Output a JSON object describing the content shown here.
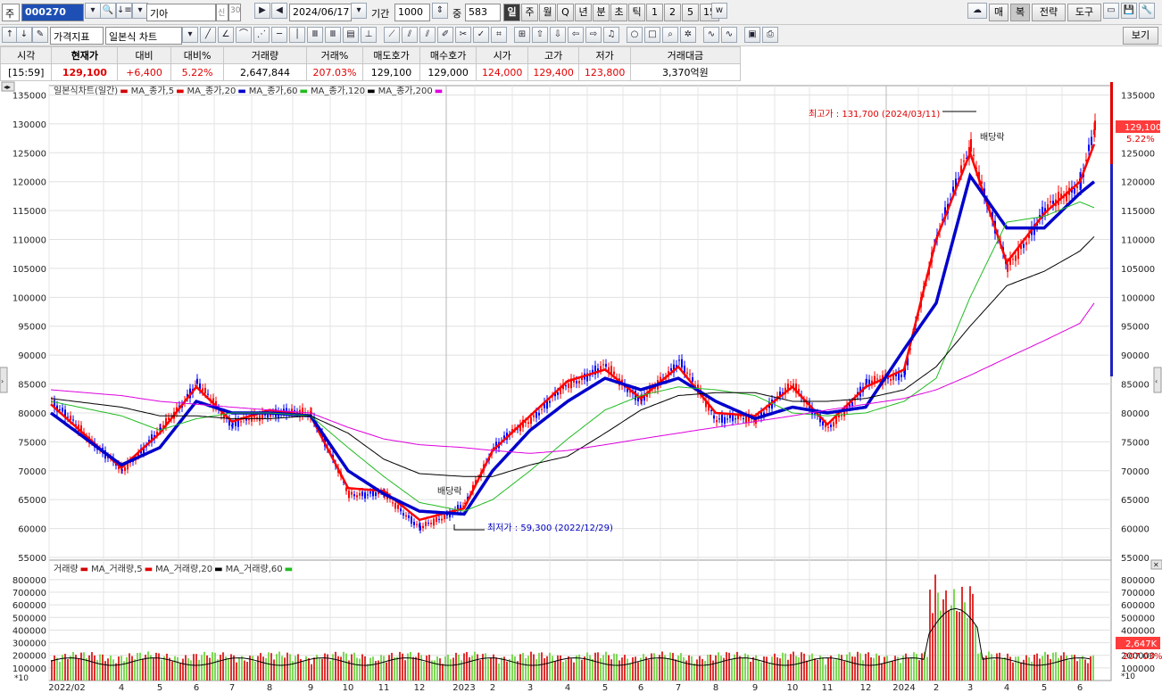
{
  "toolbar": {
    "prefix_label": "주",
    "code_value": "000270",
    "name_value": "기아",
    "tag_credit": "신",
    "tag_grade": "30",
    "date_value": "2024/06/17",
    "period_label": "기간",
    "period_value": "1000",
    "mid_label": "중",
    "mid_value": "583",
    "period_tabs": [
      "일",
      "주",
      "월",
      "Q",
      "년",
      "분",
      "초",
      "틱",
      "1",
      "2",
      "5",
      "15"
    ],
    "right_buttons": [
      "매",
      "복",
      "전략",
      "도구"
    ]
  },
  "toolbar2": {
    "indicator_label": "가격지표",
    "chart_type_value": "일본식 차트",
    "view_button": "보기"
  },
  "quote": {
    "headers": [
      "시각",
      "현재가",
      "대비",
      "대비%",
      "거래량",
      "거래%",
      "매도호가",
      "매수호가",
      "시가",
      "고가",
      "저가",
      "거래대금"
    ],
    "values": [
      "[15:59]",
      "129,100",
      "+6,400",
      "5.22%",
      "2,647,844",
      "207.03%",
      "129,100",
      "129,000",
      "124,000",
      "129,400",
      "123,800",
      "3,370억원"
    ]
  },
  "price_panel": {
    "legend": [
      {
        "text": "일본식차트(일간)",
        "color": "#d00000"
      },
      {
        "text": "MA_종가,5",
        "color": "#e00000"
      },
      {
        "text": "MA_종가,20",
        "color": "#0000cc"
      },
      {
        "text": "MA_종가,60",
        "color": "#22bb22"
      },
      {
        "text": "MA_종가,120",
        "color": "#000000"
      },
      {
        "text": "MA_종가,200",
        "color": "#dd00dd"
      }
    ],
    "y_ticks": [
      135000,
      130000,
      125000,
      120000,
      115000,
      110000,
      105000,
      100000,
      95000,
      90000,
      85000,
      80000,
      75000,
      70000,
      65000,
      60000,
      55000
    ],
    "y_min": 55000,
    "y_max": 136000,
    "high_annotation": "최고가 : 131,700 (2024/03/11)",
    "low_annotation": "최저가 : 59,300 (2022/12/29)",
    "dividend_label": "배당락",
    "current_price": "129,100",
    "current_pct": "5.22%"
  },
  "volume_panel": {
    "legend": [
      {
        "text": "거래량",
        "color": "#d00000"
      },
      {
        "text": "MA_거래량,5",
        "color": "#e00000"
      },
      {
        "text": "MA_거래량,20",
        "color": "#000000"
      },
      {
        "text": "MA_거래량,60",
        "color": "#22bb22"
      }
    ],
    "y_ticks": [
      800000,
      700000,
      600000,
      500000,
      400000,
      300000,
      200000,
      100000
    ],
    "y_max": 870000,
    "scale_label": "*10",
    "current_volume": "2,647K",
    "current_pct": "207.03%"
  },
  "x_axis": {
    "labels": [
      "2022/02",
      "4",
      "5",
      "6",
      "7",
      "8",
      "9",
      "10",
      "11",
      "12",
      "2023",
      "2",
      "3",
      "4",
      "5",
      "6",
      "7",
      "8",
      "9",
      "10",
      "11",
      "12",
      "2024",
      "2",
      "3",
      "4",
      "5",
      "6"
    ]
  },
  "chart_data": {
    "type": "line",
    "title": "",
    "xlabel": "",
    "ylabel": "",
    "x": [
      "2022/02",
      "2022/04",
      "2022/05",
      "2022/06",
      "2022/07",
      "2022/08",
      "2022/09",
      "2022/10",
      "2022/11",
      "2022/12",
      "2023/01",
      "2023/02",
      "2023/03",
      "2023/04",
      "2023/05",
      "2023/06",
      "2023/07",
      "2023/08",
      "2023/09",
      "2023/10",
      "2023/11",
      "2023/12",
      "2024/01",
      "2024/02",
      "2024/03",
      "2024/04",
      "2024/05",
      "2024/06",
      "2024/06/17"
    ],
    "ylim": [
      55000,
      136000
    ],
    "series": [
      {
        "name": "일본식차트(일간)",
        "values": [
          82000,
          70000,
          77000,
          85000,
          78000,
          80000,
          80000,
          66000,
          66000,
          60000,
          64000,
          74000,
          79000,
          85000,
          88000,
          82000,
          89000,
          79000,
          79000,
          85000,
          77000,
          85000,
          87000,
          111000,
          126000,
          105000,
          115000,
          120000,
          129100
        ]
      },
      {
        "name": "MA_종가,5",
        "values": [
          81500,
          70500,
          76500,
          84500,
          78500,
          80500,
          79500,
          67000,
          66500,
          61500,
          63500,
          73500,
          79500,
          85500,
          87500,
          82500,
          88000,
          80000,
          79500,
          84500,
          78000,
          84500,
          87500,
          110000,
          125000,
          106000,
          114500,
          120000,
          126500
        ]
      },
      {
        "name": "MA_종가,20",
        "values": [
          80000,
          71000,
          74000,
          82000,
          80000,
          80000,
          79500,
          70000,
          66000,
          63000,
          62500,
          70000,
          77000,
          82000,
          86000,
          84000,
          86000,
          82000,
          79000,
          81000,
          80000,
          81000,
          91000,
          99000,
          121000,
          112000,
          112000,
          118000,
          120000
        ]
      },
      {
        "name": "MA_종가,60",
        "values": [
          82000,
          79500,
          77000,
          79000,
          80000,
          80000,
          79500,
          74000,
          69000,
          64500,
          63000,
          65000,
          70000,
          75500,
          80500,
          83000,
          84500,
          84000,
          83000,
          80000,
          79500,
          80000,
          82000,
          86000,
          100000,
          113000,
          114000,
          116500,
          115500
        ]
      },
      {
        "name": "MA_종가,120",
        "values": [
          82500,
          81000,
          79500,
          79500,
          79000,
          79000,
          79500,
          76500,
          72000,
          69500,
          69000,
          69000,
          71000,
          72500,
          76500,
          80500,
          83000,
          83500,
          83500,
          82000,
          82000,
          82500,
          84000,
          88000,
          95000,
          102000,
          104500,
          108000,
          110500
        ]
      },
      {
        "name": "MA_종가,200",
        "values": [
          84000,
          83000,
          82000,
          81500,
          81000,
          80500,
          80000,
          77500,
          75500,
          74500,
          74000,
          73500,
          73000,
          73500,
          74500,
          75500,
          76500,
          77500,
          78500,
          79500,
          80500,
          81500,
          82500,
          84000,
          86500,
          89500,
          92500,
          95500,
          99000
        ]
      }
    ]
  }
}
